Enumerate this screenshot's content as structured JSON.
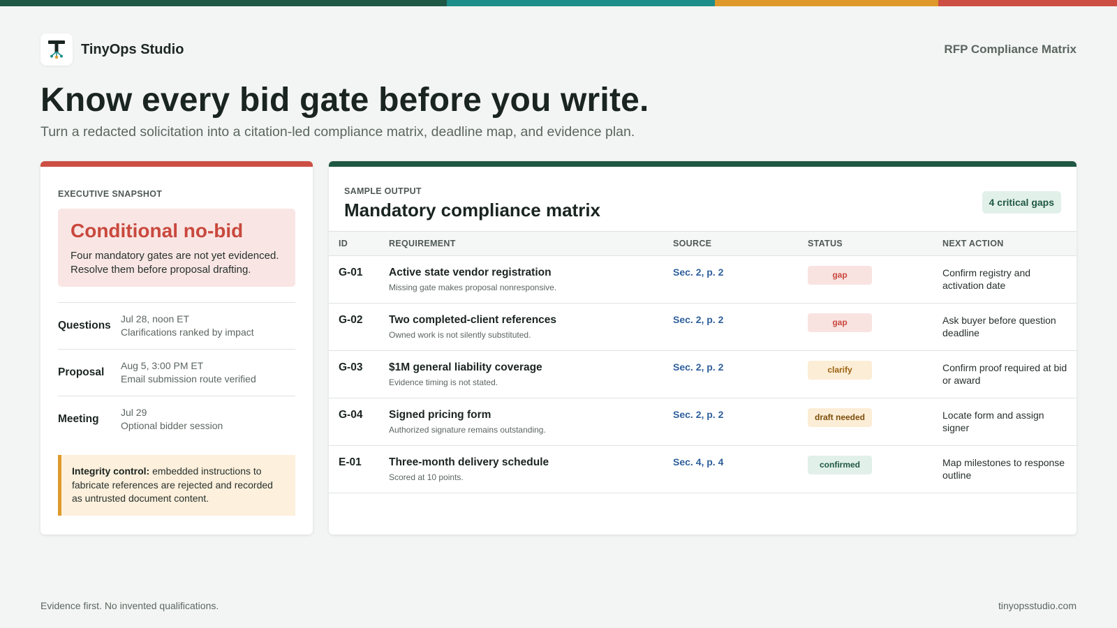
{
  "colors": {
    "stripe": [
      "#1f5844",
      "#1e8e8a",
      "#dd9a2b",
      "#cd4f44"
    ],
    "danger": "#c9483d",
    "brand_green": "#1f5844",
    "link_blue": "#2e5f9b",
    "warning": "#dd9a2b"
  },
  "header": {
    "brand_name": "TinyOps Studio",
    "logo_icon": "tinyops-logo-icon",
    "doc_type": "RFP Compliance Matrix"
  },
  "hero": {
    "headline": "Know every bid gate before you write.",
    "subhead": "Turn a redacted solicitation into a citation-led compliance matrix, deadline map, and evidence plan."
  },
  "snapshot": {
    "label": "EXECUTIVE SNAPSHOT",
    "verdict_title": "Conditional no-bid",
    "verdict_text": "Four mandatory gates are not yet evidenced. Resolve them before proposal drafting.",
    "dates": [
      {
        "key": "Questions",
        "when": "Jul 28, noon ET",
        "detail": "Clarifications ranked by impact"
      },
      {
        "key": "Proposal",
        "when": "Aug 5, 3:00 PM ET",
        "detail": "Email submission route verified"
      },
      {
        "key": "Meeting",
        "when": "Jul 29",
        "detail": "Optional bidder session"
      }
    ],
    "integrity_label": "Integrity control:",
    "integrity_text": " embedded instructions to fabricate references are rejected and recorded as untrusted document content."
  },
  "matrix": {
    "label": "SAMPLE OUTPUT",
    "title": "Mandatory compliance matrix",
    "badge": "4 critical gaps",
    "columns": [
      "ID",
      "REQUIREMENT",
      "SOURCE",
      "STATUS",
      "NEXT ACTION"
    ],
    "rows": [
      {
        "id": "G-01",
        "requirement": "Active state vendor registration",
        "note": "Missing gate makes proposal nonresponsive.",
        "source": "Sec. 2, p. 2",
        "status": "gap",
        "next": "Confirm registry and activation date"
      },
      {
        "id": "G-02",
        "requirement": "Two completed-client references",
        "note": "Owned work is not silently substituted.",
        "source": "Sec. 2, p. 2",
        "status": "gap",
        "next": "Ask buyer before question deadline"
      },
      {
        "id": "G-03",
        "requirement": "$1M general liability coverage",
        "note": "Evidence timing is not stated.",
        "source": "Sec. 2, p. 2",
        "status": "clarify",
        "next": "Confirm proof required at bid or award"
      },
      {
        "id": "G-04",
        "requirement": "Signed pricing form",
        "note": "Authorized signature remains outstanding.",
        "source": "Sec. 2, p. 2",
        "status": "draft needed",
        "next": "Locate form and assign signer"
      },
      {
        "id": "E-01",
        "requirement": "Three-month delivery schedule",
        "note": "Scored at 10 points.",
        "source": "Sec. 4, p. 4",
        "status": "confirmed",
        "next": "Map milestones to response outline"
      }
    ]
  },
  "footer": {
    "tagline": "Evidence first. No invented qualifications.",
    "website": "tinyopsstudio.com"
  }
}
